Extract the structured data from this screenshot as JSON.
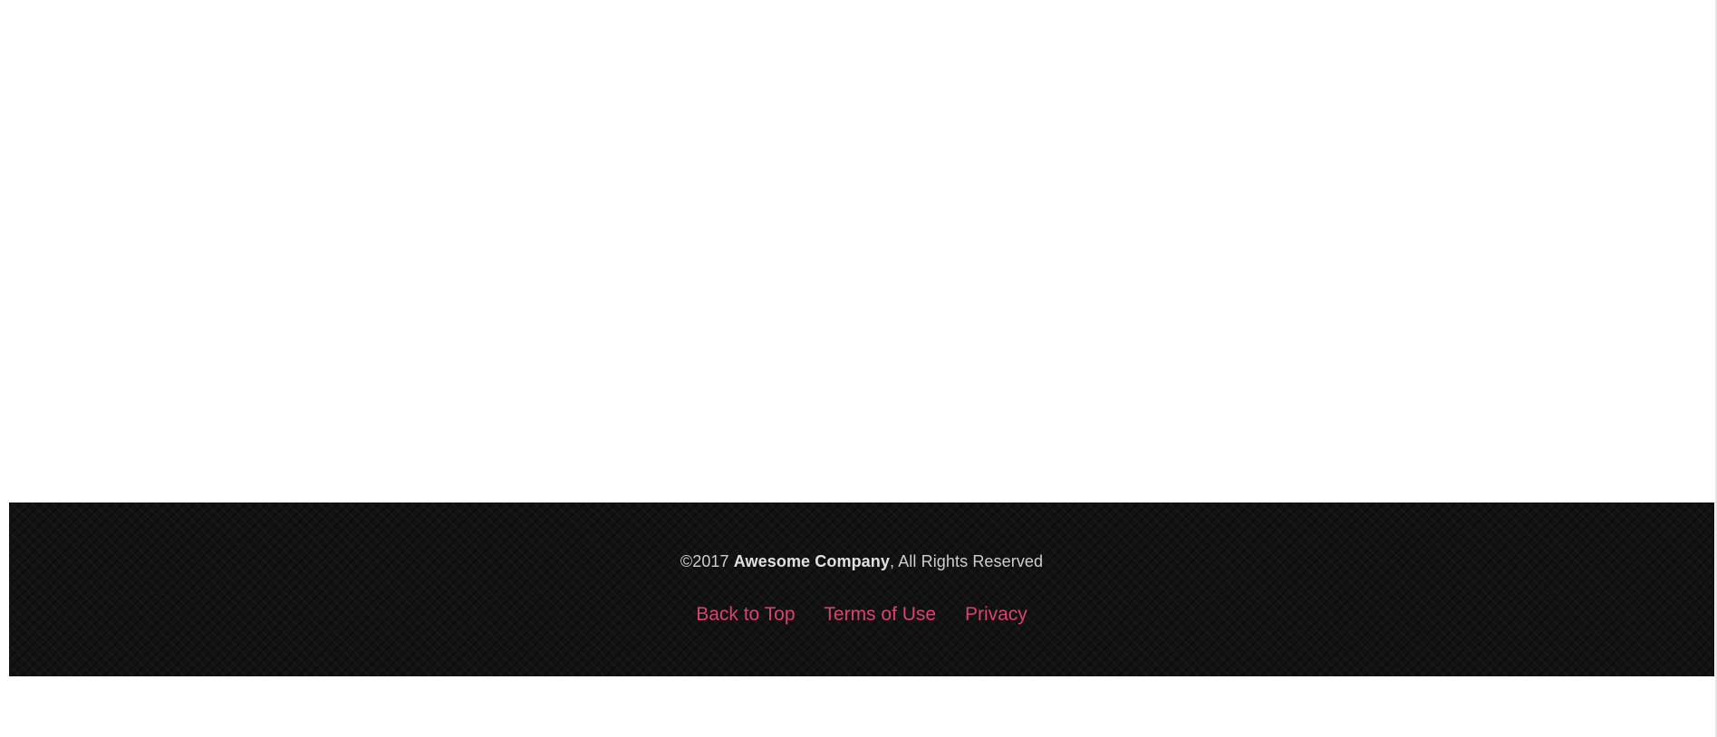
{
  "footer": {
    "copyright_prefix": "©2017 ",
    "company": "Awesome Company",
    "copyright_suffix": ", All Rights Reserved",
    "links": [
      {
        "label": "Back to Top"
      },
      {
        "label": "Terms of Use"
      },
      {
        "label": "Privacy"
      }
    ]
  },
  "colors": {
    "footer_background": "#121212",
    "link": "#d8436f",
    "text": "#cfcfcf"
  }
}
